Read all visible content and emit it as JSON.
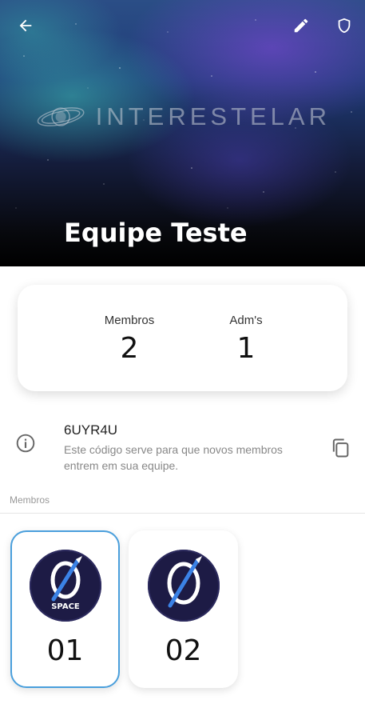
{
  "header": {
    "logo_text": "INTERESTELAR",
    "team_name": "Equipe Teste",
    "icons": [
      "arrow-left-icon",
      "pencil-icon",
      "shield-icon"
    ]
  },
  "stats": {
    "members_label": "Membros",
    "members_value": "2",
    "admins_label": "Adm's",
    "admins_value": "1"
  },
  "invite": {
    "code": "6UYR4U",
    "description": "Este código serve para que novos membros entrem em sua equipe.",
    "icons": [
      "info-icon",
      "copy-icon"
    ]
  },
  "members_section": {
    "label": "Membros",
    "members": [
      {
        "name": "01",
        "avatar_text": "SPACE",
        "selected": true
      },
      {
        "name": "02",
        "avatar_text": "",
        "selected": false
      }
    ]
  },
  "colors": {
    "selected_border": "#4a9fdc",
    "avatar_bg": "#1d1b45",
    "rocket_blue": "#3b82e6"
  }
}
